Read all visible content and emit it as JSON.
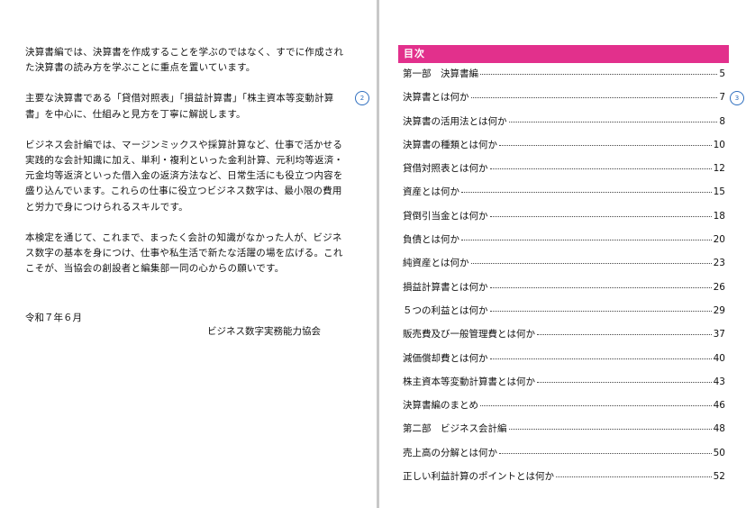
{
  "left_page": {
    "paragraphs": [
      "決算書編では、決算書を作成することを学ぶのではなく、すでに作成された決算書の読み方を学ぶことに重点を置いています。",
      "主要な決算書である「貸借対照表」「損益計算書」「株主資本等変動計算書」を中心に、仕組みと見方を丁寧に解説します。",
      "ビジネス会計編では、マージンミックスや採算計算など、仕事で活かせる実践的な会計知識に加え、単利・複利といった金利計算、元利均等返済・元金均等返済といった借入金の返済方法など、日常生活にも役立つ内容を盛り込んでいます。これらの仕事に役立つビジネス数字は、最小限の費用と労力で身につけられるスキルです。",
      "本検定を通じて、これまで、まったく会計の知識がなかった人が、ビジネス数字の基本を身につけ、仕事や私生活で新たな活躍の場を広げる。これこそが、当協会の創設者と編集部一同の心からの願いです。"
    ],
    "date": "令和７年６月",
    "organization": "ビジネス数字実務能力協会",
    "page_number": "2"
  },
  "right_page": {
    "toc_title": "目次",
    "page_number": "3",
    "toc": [
      {
        "title": "第一部　決算書編",
        "page": "5"
      },
      {
        "title": "決算書とは何か",
        "page": "7"
      },
      {
        "title": "決算書の活用法とは何か",
        "page": "8"
      },
      {
        "title": "決算書の種類とは何か",
        "page": "10"
      },
      {
        "title": "貸借対照表とは何か",
        "page": "12"
      },
      {
        "title": "資産とは何か",
        "page": "15"
      },
      {
        "title": "貸倒引当金とは何か",
        "page": "18"
      },
      {
        "title": "負債とは何か",
        "page": "20"
      },
      {
        "title": "純資産とは何か",
        "page": "23"
      },
      {
        "title": "損益計算書とは何か",
        "page": "26"
      },
      {
        "title": "５つの利益とは何か",
        "page": "29"
      },
      {
        "title": "販売費及び一般管理費とは何か",
        "page": "37"
      },
      {
        "title": "減価償却費とは何か",
        "page": "40"
      },
      {
        "title": "株主資本等変動計算書とは何か",
        "page": "43"
      },
      {
        "title": "決算書編のまとめ",
        "page": "46"
      },
      {
        "title": "第二部　ビジネス会計編",
        "page": "48"
      },
      {
        "title": "売上高の分解とは何か",
        "page": "50"
      },
      {
        "title": "正しい利益計算のポイントとは何か",
        "page": "52"
      }
    ]
  }
}
